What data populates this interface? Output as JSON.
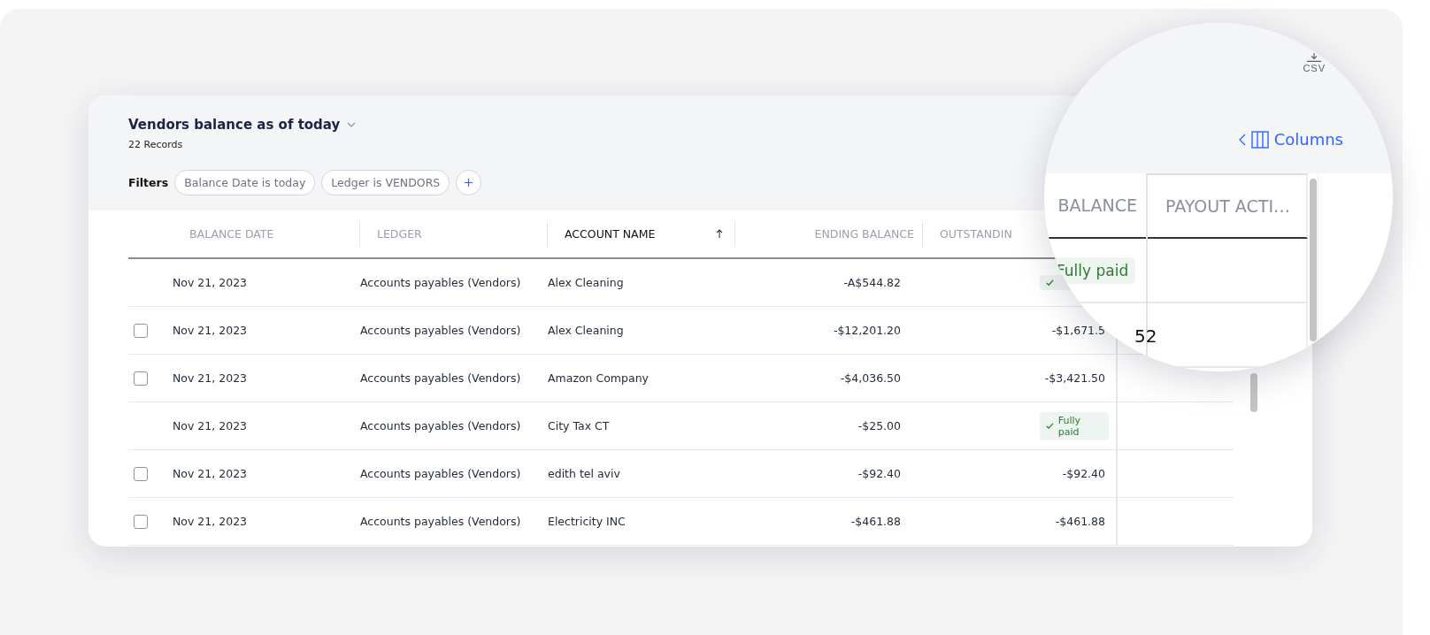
{
  "report": {
    "title": "Vendors balance as of today",
    "records": "22 Records",
    "filters_label": "Filters",
    "filters": [
      "Balance Date is today",
      "Ledger is VENDORS"
    ]
  },
  "table": {
    "columns": [
      {
        "label": "BALANCE DATE",
        "sorted": false
      },
      {
        "label": "LEDGER",
        "sorted": false
      },
      {
        "label": "ACCOUNT NAME",
        "sorted": true
      },
      {
        "label": "ENDING BALANCE",
        "sorted": false
      },
      {
        "label": "OUTSTANDIN",
        "sorted": false
      }
    ],
    "rows": [
      {
        "selectable": false,
        "date": "Nov 21, 2023",
        "ledger": "Accounts payables (Vendors)",
        "account": "Alex Cleaning",
        "ending": "-A$544.82",
        "outstanding": {
          "kind": "paid"
        }
      },
      {
        "selectable": true,
        "checked": false,
        "date": "Nov 21, 2023",
        "ledger": "Accounts payables (Vendors)",
        "account": "Alex Cleaning",
        "ending": "-$12,201.20",
        "outstanding": {
          "kind": "amount",
          "text": "-$1,671.5"
        }
      },
      {
        "selectable": true,
        "checked": false,
        "date": "Nov 21, 2023",
        "ledger": "Accounts payables (Vendors)",
        "account": "Amazon Company",
        "ending": "-$4,036.50",
        "outstanding": {
          "kind": "amount",
          "text": "-$3,421.50"
        }
      },
      {
        "selectable": false,
        "date": "Nov 21, 2023",
        "ledger": "Accounts payables (Vendors)",
        "account": "City Tax CT",
        "ending": "-$25.00",
        "outstanding": {
          "kind": "paid",
          "label": "Fully paid"
        }
      },
      {
        "selectable": true,
        "checked": false,
        "date": "Nov 21, 2023",
        "ledger": "Accounts payables (Vendors)",
        "account": "edith tel aviv",
        "ending": "-$92.40",
        "outstanding": {
          "kind": "amount",
          "text": "-$92.40"
        }
      },
      {
        "selectable": true,
        "checked": false,
        "date": "Nov 21, 2023",
        "ledger": "Accounts payables (Vendors)",
        "account": "Electricity INC",
        "ending": "-$461.88",
        "outstanding": {
          "kind": "amount",
          "text": "-$461.88"
        }
      }
    ]
  },
  "magnifier": {
    "export": {
      "label": "CSV"
    },
    "columns_button": {
      "label": "Columns"
    },
    "columns": [
      "BALANCE",
      "PAYOUT ACTI…"
    ],
    "badge": "Fully paid",
    "fragment": "52"
  }
}
